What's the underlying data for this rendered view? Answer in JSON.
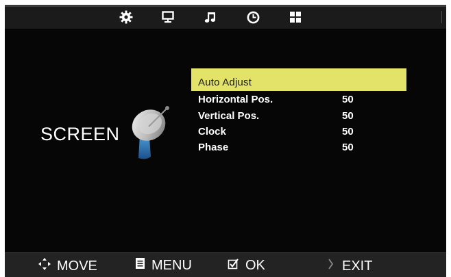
{
  "top_tabs": [
    {
      "name": "picture-tab",
      "icon": "gear-icon"
    },
    {
      "name": "screen-tab",
      "icon": "monitor-icon"
    },
    {
      "name": "sound-tab",
      "icon": "music-note-icon"
    },
    {
      "name": "time-tab",
      "icon": "clock-icon"
    },
    {
      "name": "setup-tab",
      "icon": "grid-icon"
    }
  ],
  "page": {
    "title": "SCREEN",
    "icon": "satellite-dish-icon"
  },
  "menu": {
    "items": [
      {
        "label": "Auto Adjust",
        "value": ""
      },
      {
        "label": "Horizontal Pos.",
        "value": "50"
      },
      {
        "label": "Vertical Pos.",
        "value": "50"
      },
      {
        "label": "Clock",
        "value": "50"
      },
      {
        "label": "Phase",
        "value": "50"
      }
    ],
    "highlight_color": "#e3e36a"
  },
  "footer": {
    "move_label": "MOVE",
    "menu_label": "MENU",
    "ok_label": "OK",
    "exit_label": "EXIT"
  }
}
